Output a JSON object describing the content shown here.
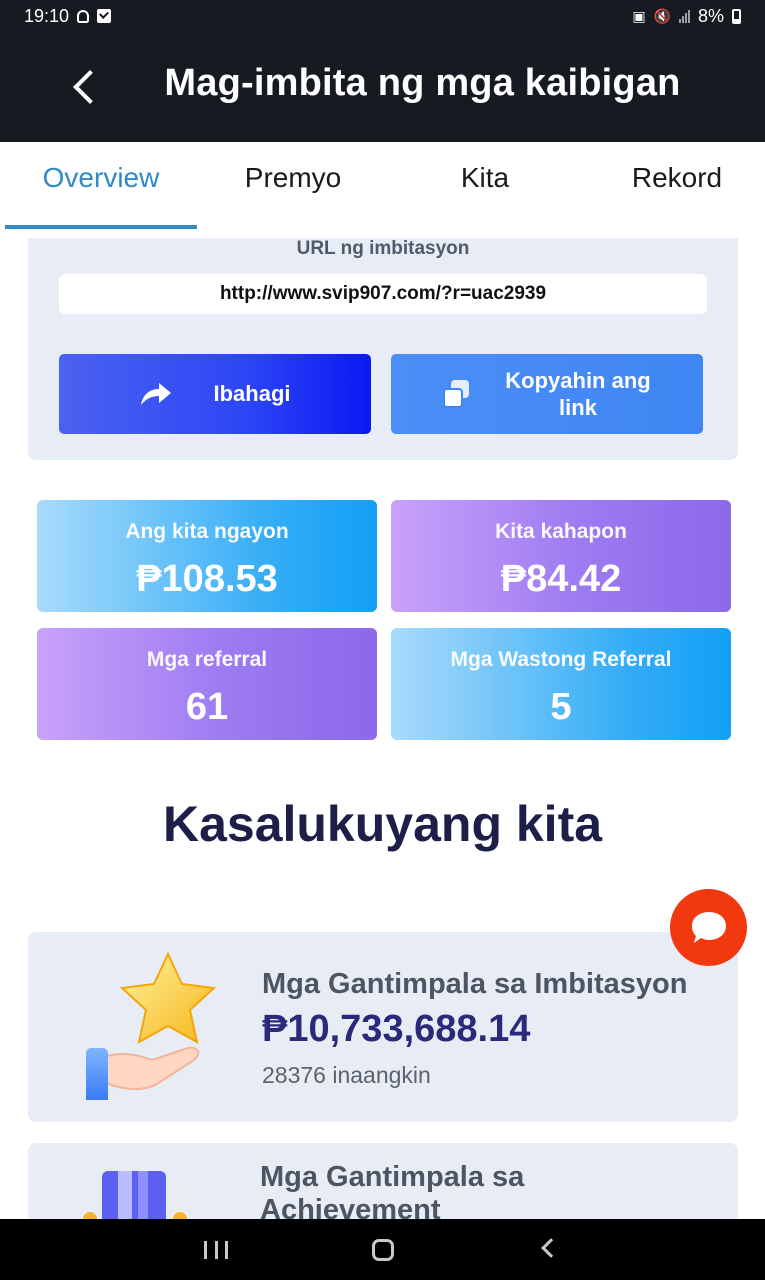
{
  "status_bar": {
    "time": "19:10",
    "battery": "8%",
    "icons": [
      "bell-icon",
      "checkbox-notification-icon",
      "lock-icon",
      "mute-icon",
      "wifi-icon",
      "signal-icon",
      "battery-icon"
    ]
  },
  "app_bar": {
    "title": "Mag-imbita ng mga kaibigan",
    "back_icon": "chevron-left-icon"
  },
  "tabs": [
    {
      "label": "Overview",
      "active": true
    },
    {
      "label": "Premyo",
      "active": false
    },
    {
      "label": "Kita",
      "active": false
    },
    {
      "label": "Rekord",
      "active": false
    }
  ],
  "invite": {
    "label": "URL ng imbitasyon",
    "url": "http://www.svip907.com/?r=uac2939",
    "share_label": "Ibahagi",
    "copy_label_line1": "Kopyahin ang",
    "copy_label_line2": "link"
  },
  "stats": [
    {
      "label": "Ang kita ngayon",
      "value": "₱108.53"
    },
    {
      "label": "Kita kahapon",
      "value": "₱84.42"
    },
    {
      "label": "Mga referral",
      "value": "61"
    },
    {
      "label": "Mga Wastong Referral",
      "value": "5"
    }
  ],
  "section_title": "Kasalukuyang kita",
  "rewards": [
    {
      "title": "Mga Gantimpala sa Imbitasyon",
      "amount": "₱10,733,688.14",
      "sub": "28376 inaangkin"
    },
    {
      "title_line1": "Mga Gantimpala sa",
      "title_line2": "Achievement"
    }
  ],
  "colors": {
    "accent": "#2f8ac6",
    "header_bg": "#161b22",
    "chat_fab": "#f2380f",
    "heading": "#1d1f49"
  }
}
